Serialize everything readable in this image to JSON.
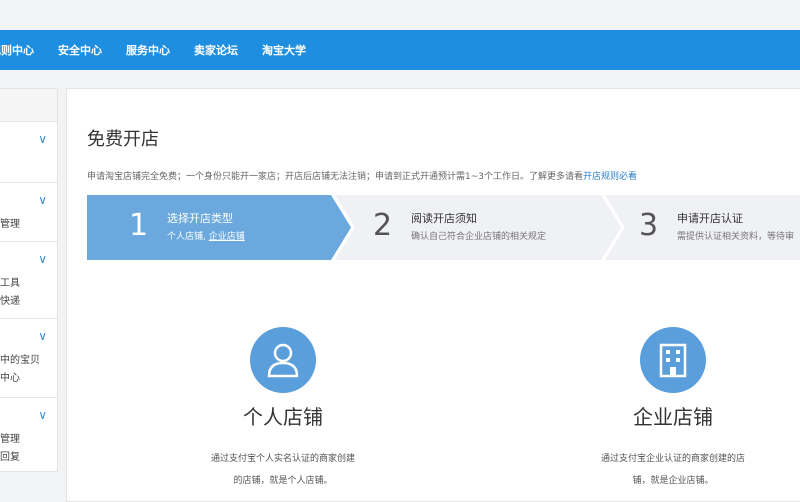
{
  "topnav": {
    "items": [
      {
        "label": "规则中心"
      },
      {
        "label": "安全中心"
      },
      {
        "label": "服务中心"
      },
      {
        "label": "卖家论坛"
      },
      {
        "label": "淘宝大学"
      }
    ]
  },
  "sidebar": {
    "groups": [
      {
        "lines": []
      },
      {
        "lines": [
          "价管理"
        ]
      },
      {
        "lines": [
          "流工具",
          "寄快递"
        ]
      },
      {
        "lines": [
          "库中的宝贝",
          "检中心"
        ]
      },
      {
        "lines": [
          "价管理",
          "问回复"
        ]
      }
    ]
  },
  "main": {
    "title": "免费开店",
    "notice": "申请淘宝店铺完全免费；一个身份只能开一家店；开店后店铺无法注销；申请到正式开通预计需1~3个工作日。了解更多请看",
    "notice_link": "开店规则必看",
    "steps": [
      {
        "num": "1",
        "title": "选择开店类型",
        "desc_a": "个人店铺,",
        "desc_b": "企业店铺"
      },
      {
        "num": "2",
        "title": "阅读开店须知",
        "desc": "确认自己符合企业店铺的相关规定"
      },
      {
        "num": "3",
        "title": "申请开店认证",
        "desc": "需提供认证相关资料，等待审"
      }
    ],
    "cards": [
      {
        "name": "个人店铺",
        "desc1": "通过支付宝个人实名认证的商家创建",
        "desc2": "的店铺，就是个人店铺。"
      },
      {
        "name": "企业店铺",
        "desc1": "通过支付宝企业认证的商家创建的店",
        "desc2": "铺，就是企业店铺。"
      }
    ]
  },
  "colors": {
    "topbar": "#1e8fe0",
    "step_active": "#6aa8de",
    "step_inactive": "#f0f1f4",
    "accent": "#5a9fdb"
  }
}
